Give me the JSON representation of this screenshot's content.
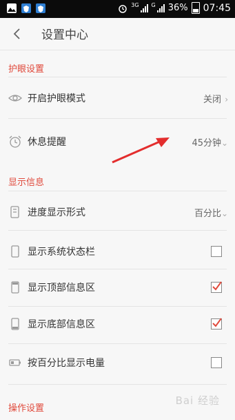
{
  "status_bar": {
    "net_a": "3G",
    "net_b": "G",
    "battery": "36%",
    "time": "07:45"
  },
  "header": {
    "title": "设置中心"
  },
  "sections": {
    "eye": "护眼设置",
    "display": "显示信息",
    "operation": "操作设置"
  },
  "rows": {
    "eye_mode": {
      "label": "开启护眼模式",
      "value": "关闭"
    },
    "rest": {
      "label": "休息提醒",
      "value": "45分钟"
    },
    "progress": {
      "label": "进度显示形式",
      "value": "百分比"
    },
    "status_bar": {
      "label": "显示系统状态栏",
      "checked": false
    },
    "top_info": {
      "label": "显示顶部信息区",
      "checked": true
    },
    "bottom_info": {
      "label": "显示底部信息区",
      "checked": true
    },
    "battery_pct": {
      "label": "按百分比显示电量",
      "checked": false
    }
  },
  "colors": {
    "accent": "#e04a3c",
    "annotation": "#e32d2d"
  },
  "watermark": "Bai 经验"
}
